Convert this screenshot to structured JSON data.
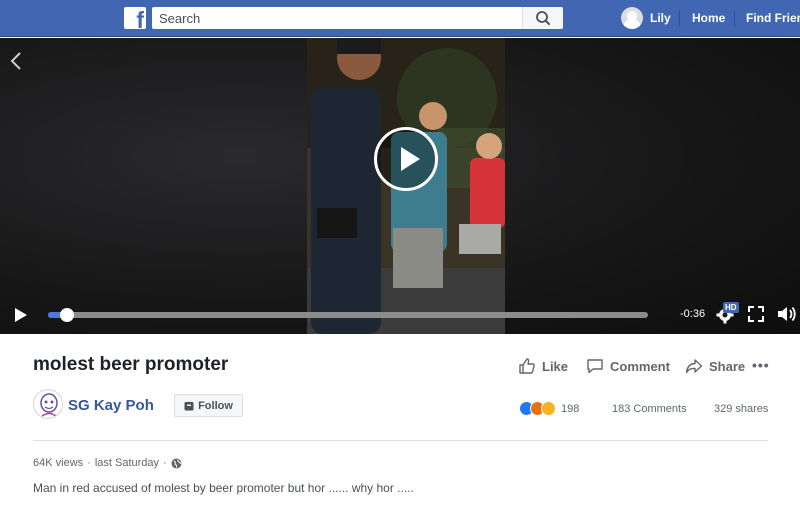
{
  "header": {
    "logo_letter": "f",
    "search": {
      "placeholder": "Search"
    },
    "user_name": "Lily",
    "nav": {
      "home": "Home",
      "find_friends": "Find Frien"
    }
  },
  "video": {
    "time_remaining": "-0:36",
    "quality_badge": "HD",
    "progress_fraction": 0.032
  },
  "post": {
    "title": "molest beer promoter",
    "actions": {
      "like": "Like",
      "comment": "Comment",
      "share": "Share",
      "more": "•••"
    },
    "page_name": "SG Kay Poh",
    "follow_label": "Follow",
    "reaction_count": "198",
    "comments": "183 Comments",
    "shares": "329 shares",
    "views": "64K views",
    "posted": "last Saturday",
    "separator": "·",
    "description": "Man in red accused of molest by beer promoter but hor ...... why hor .....",
    "reactions": [
      "like",
      "angry",
      "haha"
    ]
  },
  "colors": {
    "brand_blue": "#4267b2",
    "link_blue": "#385898",
    "progress_blue": "#4b7bd8"
  }
}
